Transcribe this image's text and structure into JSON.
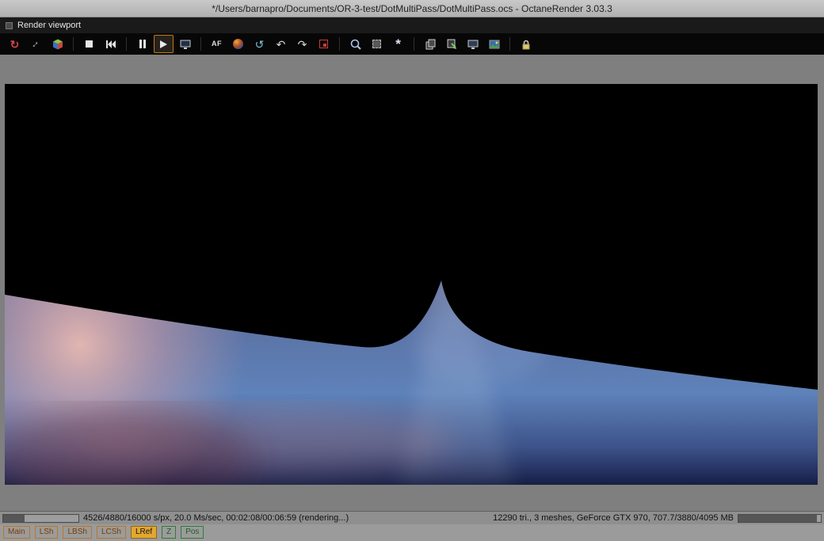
{
  "window": {
    "title": "*/Users/barnapro/Documents/OR-3-test/DotMultiPass/DotMultiPass.ocs - OctaneRender 3.03.3"
  },
  "viewport": {
    "header_title": "Render viewport"
  },
  "toolbar": {
    "icons": [
      {
        "name": "reload-icon",
        "glyph": "↻"
      },
      {
        "name": "expand-icon",
        "glyph": "↕"
      },
      {
        "name": "cube-icon"
      },
      {
        "name": "stop-icon"
      },
      {
        "name": "restart-icon"
      },
      {
        "name": "pause-icon"
      },
      {
        "name": "play-icon",
        "active": true
      },
      {
        "name": "display-icon"
      },
      {
        "name": "af-picker-icon",
        "glyph": "AF"
      },
      {
        "name": "material-picker-icon"
      },
      {
        "name": "white-balance-picker-icon",
        "glyph": "↺"
      },
      {
        "name": "camera-target-picker-icon",
        "glyph": "↶"
      },
      {
        "name": "object-picker-icon",
        "glyph": "↷"
      },
      {
        "name": "render-region-icon"
      },
      {
        "name": "zoom-icon"
      },
      {
        "name": "film-region-icon"
      },
      {
        "name": "render-priority-icon",
        "glyph": "*"
      },
      {
        "name": "copy-icon"
      },
      {
        "name": "export-icon"
      },
      {
        "name": "display2-icon"
      },
      {
        "name": "save-image-icon"
      },
      {
        "name": "lock-resolution-icon"
      }
    ]
  },
  "status_bar": {
    "render_progress_text": "4526/4880/16000 s/px, 20.0 Ms/sec, 00:02:08/00:06:59 (rendering...)",
    "render_progress_pct": 28,
    "scene_info_text": "12290 tri., 3 meshes, GeForce GTX 970, 707.7/3880/4095 MB",
    "memory_progress_pct": 95
  },
  "passes": [
    {
      "label": "Main",
      "group": "beauty",
      "active": false
    },
    {
      "label": "LSh",
      "group": "beauty",
      "active": false
    },
    {
      "label": "LBSh",
      "group": "beauty",
      "active": false
    },
    {
      "label": "LCSh",
      "group": "beauty",
      "active": false
    },
    {
      "label": "LRef",
      "group": "beauty",
      "active": true
    },
    {
      "label": "Z",
      "group": "info",
      "active": false
    },
    {
      "label": "Pos",
      "group": "info",
      "active": false
    }
  ],
  "colors": {
    "toolbar_active_border": "#c07818",
    "pass_orange_border": "#b5782a",
    "pass_green_border": "#2e7d32",
    "pass_active_bg": "#e3a72f",
    "status_bg": "#8f8f8f",
    "render_sky": "#000000",
    "render_ground_blue": "#5e82ba",
    "render_glow_pink": "#f0bdb2"
  }
}
